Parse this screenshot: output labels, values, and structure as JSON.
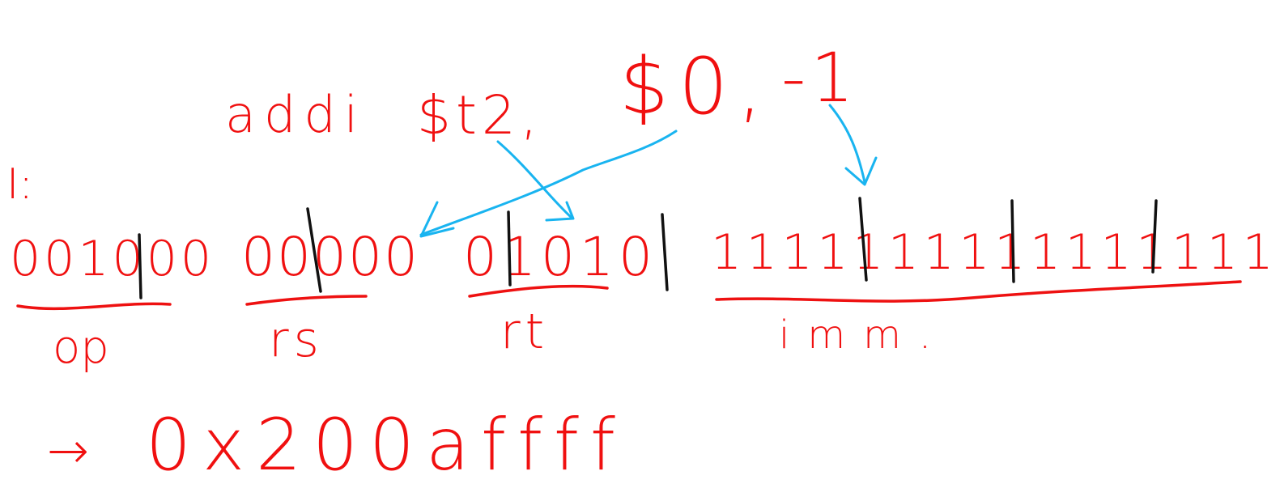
{
  "instruction": {
    "mnemonic": "addi",
    "dest": "$t2,",
    "src": "$0,",
    "immediate": "-1"
  },
  "format_label": "I:",
  "fields": [
    {
      "bits": "001000",
      "name": "op"
    },
    {
      "bits": "00000",
      "name": "rs"
    },
    {
      "bits": "01010",
      "name": "rt"
    },
    {
      "bits": "1111111111111111",
      "name": "imm."
    }
  ],
  "result": {
    "arrow": "→",
    "hex": "0x200affff"
  },
  "colors": {
    "ink": "#ee1111",
    "arrows": "#19b4f0",
    "separators": "#111111"
  }
}
